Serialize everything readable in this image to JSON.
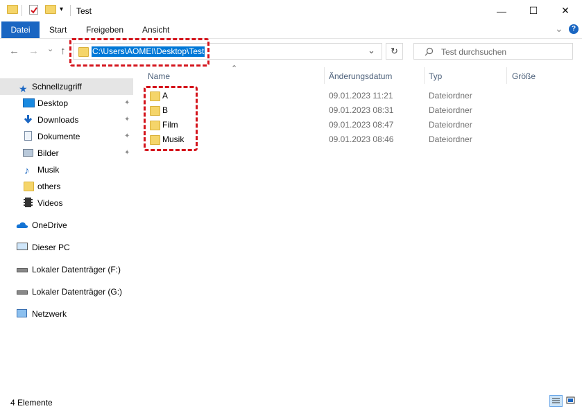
{
  "window": {
    "title": "Test",
    "controls": {
      "minimize": "—",
      "maximize": "☐",
      "close": "✕"
    }
  },
  "ribbon": {
    "tabs": [
      {
        "label": "Datei"
      },
      {
        "label": "Start"
      },
      {
        "label": "Freigeben"
      },
      {
        "label": "Ansicht"
      }
    ],
    "expand_glyph": "⌄",
    "help_glyph": "?"
  },
  "navigation": {
    "back_glyph": "←",
    "forward_glyph": "→",
    "recent_glyph": "⌄",
    "up_glyph": "↑",
    "address": "C:\\Users\\AOMEI\\Desktop\\Test",
    "dropdown_glyph": "⌄",
    "refresh_glyph": "↻",
    "search_placeholder": "Test durchsuchen",
    "sort_glyph": "⌃"
  },
  "sidebar": {
    "quick_access": "Schnellzugriff",
    "items": [
      {
        "label": "Desktop",
        "pinned": true
      },
      {
        "label": "Downloads",
        "pinned": true
      },
      {
        "label": "Dokumente",
        "pinned": true
      },
      {
        "label": "Bilder",
        "pinned": true
      },
      {
        "label": "Musik",
        "pinned": false
      },
      {
        "label": "others",
        "pinned": false
      },
      {
        "label": "Videos",
        "pinned": false
      }
    ],
    "onedrive": "OneDrive",
    "this_pc": "Dieser PC",
    "drive_f": "Lokaler Datenträger (F:)",
    "drive_g": "Lokaler Datenträger (G:)",
    "network": "Netzwerk",
    "pin_glyph": "📌"
  },
  "columns": {
    "name": "Name",
    "date": "Änderungsdatum",
    "type": "Typ",
    "size": "Größe"
  },
  "files": [
    {
      "name": "A",
      "date": "09.01.2023 11:21",
      "type": "Dateiordner"
    },
    {
      "name": "B",
      "date": "09.01.2023 08:31",
      "type": "Dateiordner"
    },
    {
      "name": "Film",
      "date": "09.01.2023 08:47",
      "type": "Dateiordner"
    },
    {
      "name": "Musik",
      "date": "09.01.2023 08:46",
      "type": "Dateiordner"
    }
  ],
  "status": {
    "count": "4 Elemente"
  },
  "colors": {
    "accent": "#0078d7",
    "tab_accent": "#1a66c2",
    "highlight": "#d4141c",
    "folder": "#f5d56a"
  }
}
